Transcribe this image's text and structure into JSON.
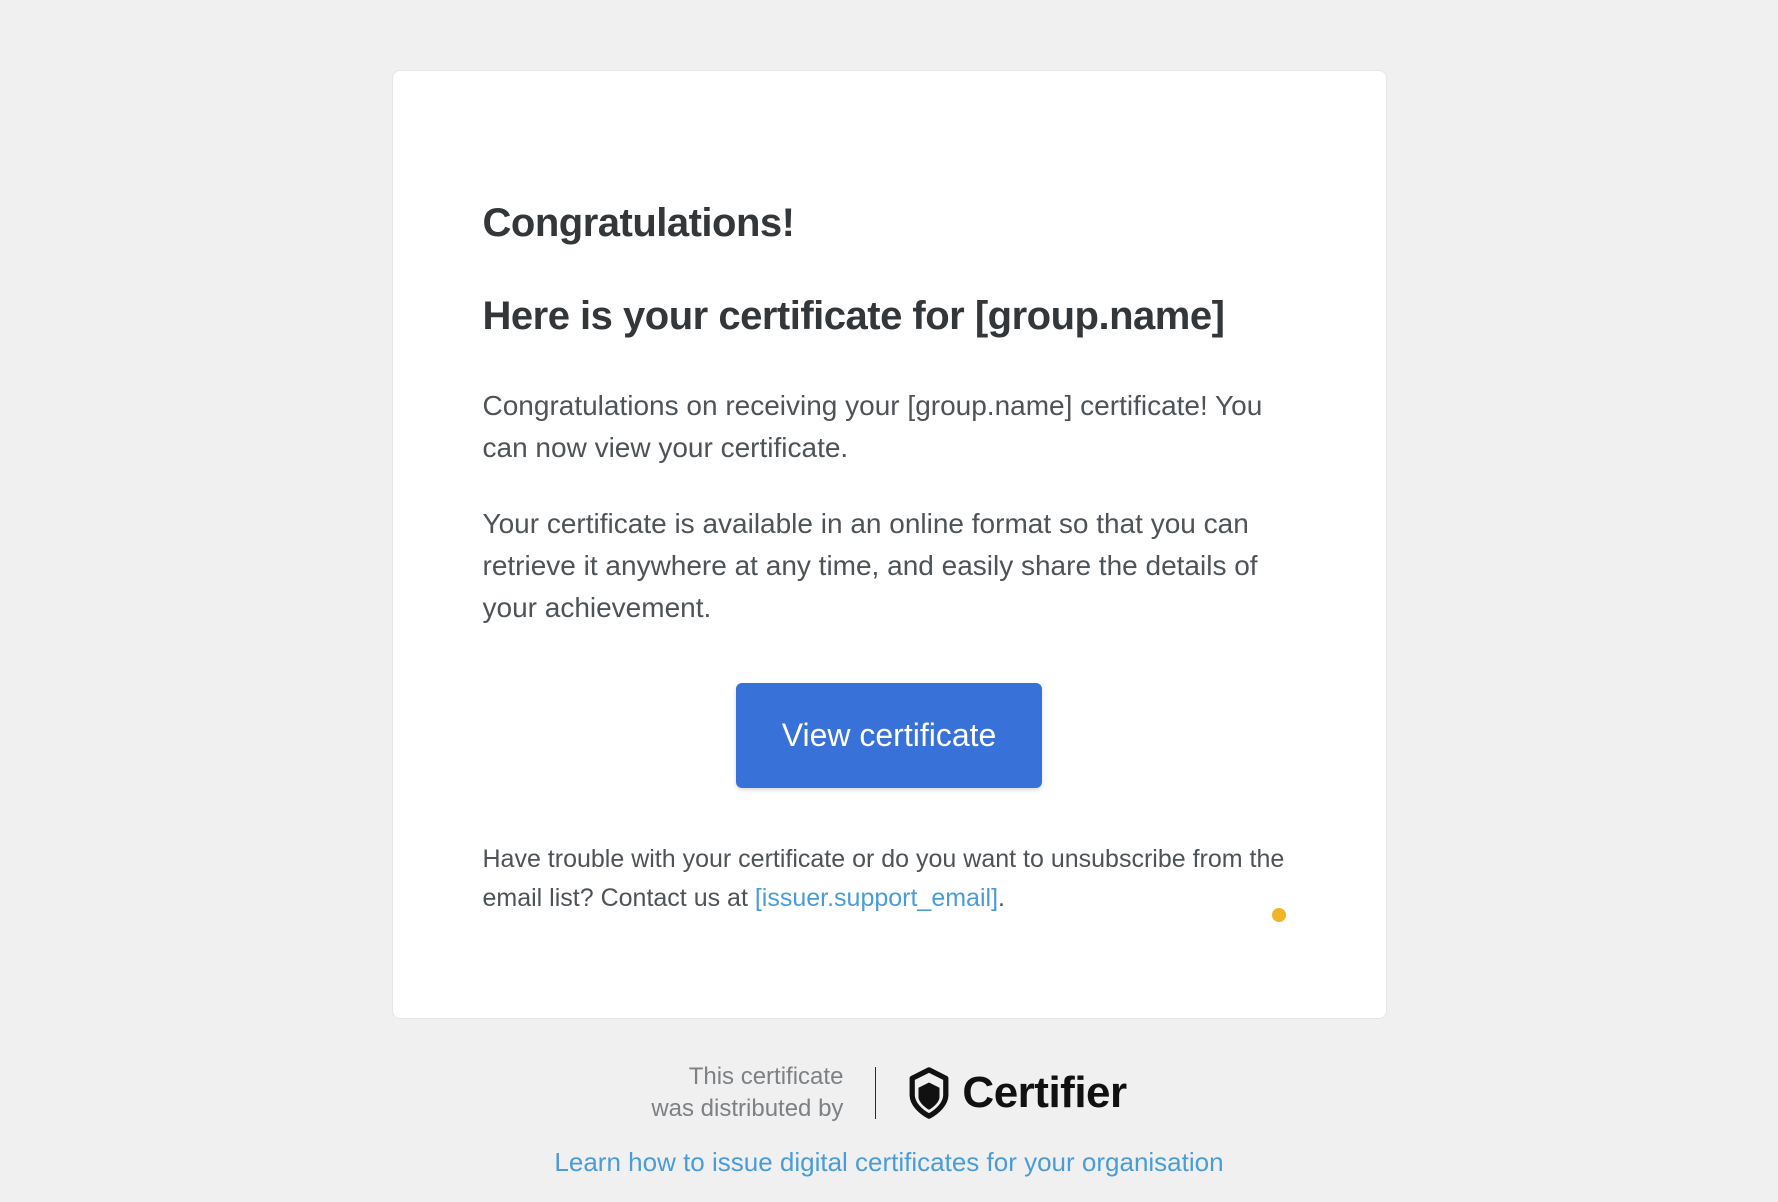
{
  "card": {
    "heading1": "Congratulations!",
    "heading2": "Here is your certificate for [group.name]",
    "paragraph1": "Congratulations on receiving your [group.name] certificate! You can now view your certificate.",
    "paragraph2": "Your certificate is available in an online format so that you can retrieve it anywhere at any time, and easily share the details of your achievement.",
    "button_label": "View certificate",
    "help_text_prefix": "Have trouble with your certificate or do you want to unsubscribe from the email list? Contact us at ",
    "help_email": "[issuer.support_email]",
    "help_text_suffix": "."
  },
  "footer": {
    "distributed_line1": "This certificate",
    "distributed_line2": "was distributed by",
    "brand_name": "Certifier",
    "learn_link": "Learn how to issue digital certificates for your organisation"
  }
}
